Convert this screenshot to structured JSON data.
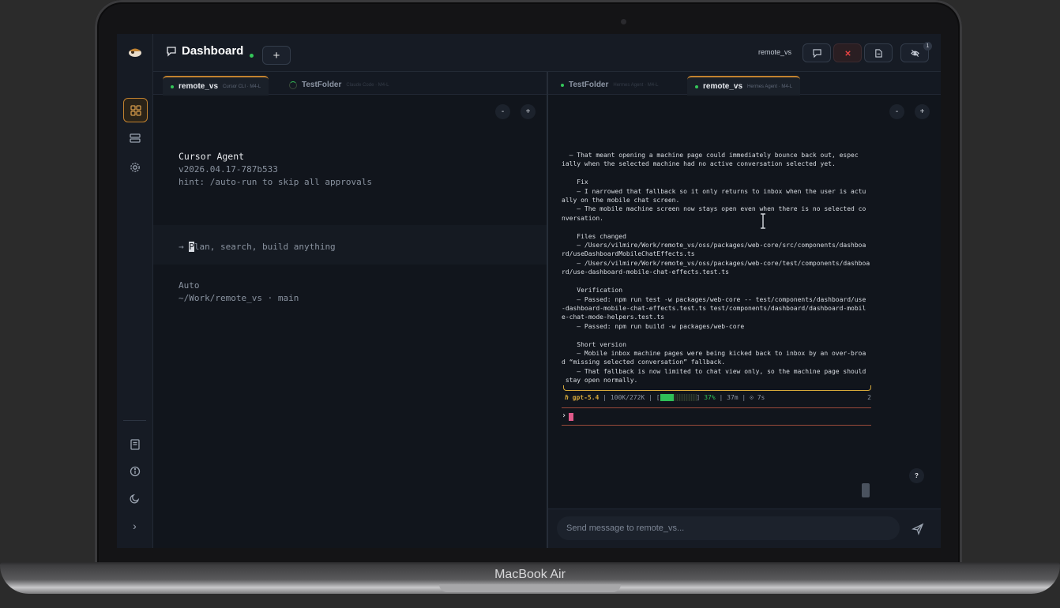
{
  "device": {
    "brand": "MacBook Air"
  },
  "header": {
    "title": "Dashboard",
    "add_label": "+",
    "machine": "remote_vs",
    "notifications_badge": "1"
  },
  "sidebar": {
    "items": [
      {
        "icon": "grid-icon",
        "active": true
      },
      {
        "icon": "server-icon"
      },
      {
        "icon": "gear-icon"
      }
    ],
    "bottom": [
      {
        "icon": "book-icon"
      },
      {
        "icon": "info-icon"
      },
      {
        "icon": "moon-icon"
      },
      {
        "icon": "chevron-right-icon",
        "label": "›"
      }
    ]
  },
  "left_pane": {
    "tabs": [
      {
        "name": "remote_vs",
        "sub": "Cursor CLI · M4-L",
        "active": true
      },
      {
        "name": "TestFolder",
        "sub": "Claude Code · M4-L",
        "active": false
      }
    ],
    "zoom_out": "-",
    "zoom_in": "+",
    "terminal": {
      "title": "Cursor Agent",
      "version": "v2026.04.17-787b533",
      "hint": "hint: /auto-run to skip all approvals",
      "prompt_arrow": "→ ",
      "prompt_first": "P",
      "prompt_rest": "lan, search, build anything",
      "mode": "Auto",
      "path": "~/Work/remote_vs · main"
    }
  },
  "right_pane": {
    "tabs": [
      {
        "name": "TestFolder",
        "sub": "Hermes Agent · M4-L",
        "active": false
      },
      {
        "name": "remote_vs",
        "sub": "Hermes Agent · M4-L",
        "active": true
      }
    ],
    "zoom_out": "-",
    "zoom_in": "+",
    "log": "  – That meant opening a machine page could immediately bounce back out, espec\nially when the selected machine had no active conversation selected yet.\n\n    Fix\n    – I narrowed that fallback so it only returns to inbox when the user is actu\nally on the mobile chat screen.\n    – The mobile machine screen now stays open even when there is no selected co\nnversation.\n\n    Files changed\n    – /Users/vilmire/Work/remote_vs/oss/packages/web-core/src/components/dashboa\nrd/useDashboardMobileChatEffects.ts\n    – /Users/vilmire/Work/remote_vs/oss/packages/web-core/test/components/dashboa\nrd/use-dashboard-mobile-chat-effects.test.ts\n\n    Verification\n    – Passed: npm run test -w packages/web-core -- test/components/dashboard/use\n-dashboard-mobile-chat-effects.test.ts test/components/dashboard/dashboard-mobil\ne-chat-mode-helpers.test.ts\n    – Passed: npm run build -w packages/web-core\n\n    Short version\n    – Mobile inbox machine pages were being kicked back to inbox by an over-broa\nd “missing selected conversation” fallback.\n    – That fallback is now limited to chat view only, so the machine page should\n stay open normally.",
    "status": {
      "glyph": "ℏ",
      "model": "gpt-5.4",
      "tokens": "100K/272K",
      "bar_open": "[",
      "bar_close": "]",
      "context_pct": 37,
      "pct_label": "37%",
      "elapsed": "37m",
      "last": "⊙ 7s",
      "sep": "|",
      "trail": "2"
    },
    "prompt_chevron": "›",
    "help": "?",
    "composer_placeholder": "Send message to remote_vs..."
  },
  "colors": {
    "accent": "#c2822f",
    "online": "#34c759",
    "model": "#d6a93a",
    "danger": "#ef4444"
  }
}
